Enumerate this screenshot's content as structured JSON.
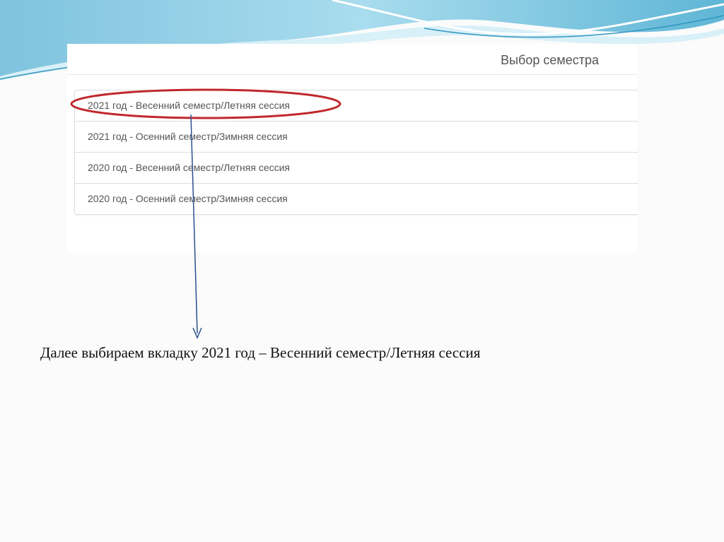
{
  "panel": {
    "title": "Выбор семестра",
    "semesters": [
      "2021 год - Весенний семестр/Летняя сессия",
      "2021 год - Осенний семестр/Зимняя сессия",
      "2020 год - Весенний семестр/Летняя сессия",
      "2020 год - Осенний семестр/Зимняя сессия"
    ]
  },
  "caption": "Далее выбираем вкладку 2021 год – Весенний семестр/Летняя сессия",
  "colors": {
    "highlight_ellipse": "#c0282d",
    "arrow": "#2b4f8f",
    "wave_light": "#bfe6f2",
    "wave_dark": "#3aa3c6"
  }
}
